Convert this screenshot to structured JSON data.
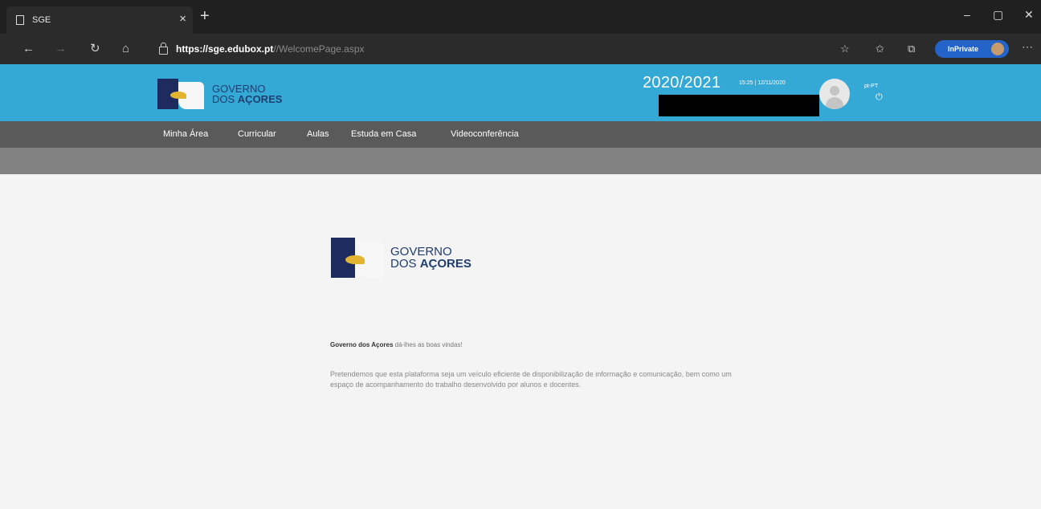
{
  "browser": {
    "tab_title": "SGE",
    "tab_close": "×",
    "new_tab": "+",
    "url_host": "https://sge.edubox.pt",
    "url_path": "//WelcomePage.aspx",
    "inprivate_label": "InPrivate",
    "window": {
      "minimize": "–",
      "maximize": "▢",
      "close": "✕"
    }
  },
  "header": {
    "logo": {
      "line1": "GOVERNO",
      "line2_prefix": "DOS ",
      "line2_bold": "AÇORES"
    },
    "school_year": "2020/2021",
    "datetime": "15:25 | 12/11/2020",
    "language": "pt-PT",
    "power_symbol": "⏻"
  },
  "menu": {
    "items": [
      "Minha Área",
      "Curricular",
      "Aulas",
      "Estuda em Casa",
      "Videoconferência"
    ]
  },
  "main": {
    "logo": {
      "line1": "GOVERNO",
      "line2_prefix": "DOS ",
      "line2_bold": "AÇORES"
    },
    "welcome_bold": "Governo dos Açores",
    "welcome_rest": " dá-lhes as boas vindas!",
    "intro_text": "Pretendemos que esta plataforma seja um veículo eficiente de disponibilização de informação e comunicação, bem como um espaço de acompanhamento do trabalho desenvolvido por alunos e docentes."
  },
  "colors": {
    "header_blue": "#35a9d6",
    "menu_gray": "#5a5a5a",
    "subbar_gray": "#828282",
    "logo_navy": "#1f3d6e",
    "inprivate_blue": "#2463c8"
  }
}
